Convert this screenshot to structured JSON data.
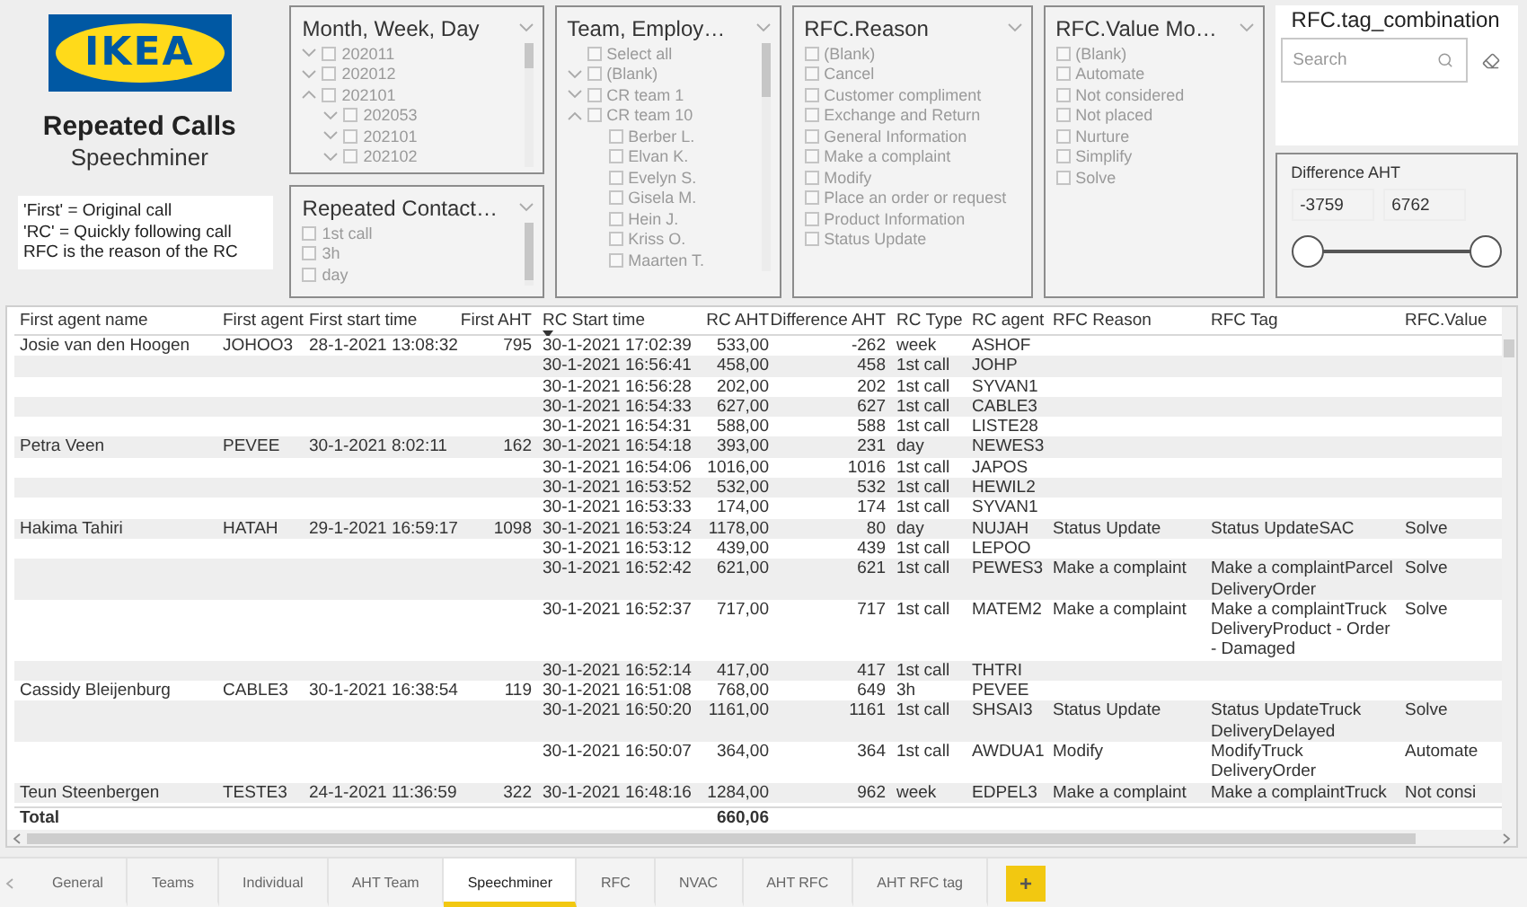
{
  "logo": {
    "text": "IKEA"
  },
  "title": "Repeated Calls",
  "subtitle": "Speechminer",
  "legend": [
    "'First' = Original call",
    "'RC' = Quickly following call",
    "RFC is the reason of the RC"
  ],
  "month_slicer": {
    "title": "Month, Week, Day",
    "items": [
      {
        "label": "202011",
        "checked": false,
        "expanded": false
      },
      {
        "label": "202012",
        "checked": false,
        "expanded": false
      },
      {
        "label": "202101",
        "checked": false,
        "expanded": true,
        "children": [
          {
            "label": "202053",
            "checked": false,
            "expanded": false
          },
          {
            "label": "202101",
            "checked": false,
            "expanded": false
          },
          {
            "label": "202102",
            "checked": false,
            "expanded": false
          }
        ]
      }
    ]
  },
  "contact_slicer": {
    "title": "Repeated Contact…",
    "items": [
      {
        "label": "1st call",
        "checked": false
      },
      {
        "label": "3h",
        "checked": false
      },
      {
        "label": "day",
        "checked": false
      }
    ]
  },
  "team_slicer": {
    "title": "Team, Employ…",
    "items": [
      {
        "label": "Select all",
        "checked": false
      },
      {
        "label": "(Blank)",
        "checked": false,
        "expanded": false
      },
      {
        "label": "CR team 1",
        "checked": false,
        "expanded": false
      },
      {
        "label": "CR team 10",
        "checked": false,
        "expanded": true,
        "children": [
          {
            "label": "Berber L.",
            "checked": false
          },
          {
            "label": "Elvan K.",
            "checked": false
          },
          {
            "label": "Evelyn S.",
            "checked": false
          },
          {
            "label": "Gisela M.",
            "checked": false
          },
          {
            "label": "Hein J.",
            "checked": false
          },
          {
            "label": "Kriss O.",
            "checked": false
          },
          {
            "label": "Maarten T.",
            "checked": false
          }
        ]
      }
    ]
  },
  "reason_slicer": {
    "title": "RFC.Reason",
    "items": [
      {
        "label": "(Blank)",
        "checked": false
      },
      {
        "label": "Cancel",
        "checked": false
      },
      {
        "label": "Customer compliment",
        "checked": false
      },
      {
        "label": "Exchange and Return",
        "checked": false
      },
      {
        "label": "General Information",
        "checked": false
      },
      {
        "label": "Make a complaint",
        "checked": false
      },
      {
        "label": "Modify",
        "checked": false
      },
      {
        "label": "Place an order or request",
        "checked": false
      },
      {
        "label": "Product Information",
        "checked": false
      },
      {
        "label": "Status Update",
        "checked": false
      }
    ]
  },
  "value_slicer": {
    "title": "RFC.Value Mo…",
    "items": [
      {
        "label": "(Blank)",
        "checked": false
      },
      {
        "label": "Automate",
        "checked": false
      },
      {
        "label": "Not considered",
        "checked": false
      },
      {
        "label": "Not placed",
        "checked": false
      },
      {
        "label": "Nurture",
        "checked": false
      },
      {
        "label": "Simplify",
        "checked": false
      },
      {
        "label": "Solve",
        "checked": false
      }
    ]
  },
  "tag_search": {
    "title": "RFC.tag_combination",
    "placeholder": "Search"
  },
  "difference_aht": {
    "title": "Difference AHT",
    "min": "-3759",
    "max": "6762",
    "handles": [
      {
        "level": 0
      },
      {
        "level": 1
      }
    ]
  },
  "table": {
    "columns": [
      {
        "label": "First agent name",
        "kind": "text",
        "sorted": false
      },
      {
        "label": "First agent",
        "kind": "text",
        "sorted": false
      },
      {
        "label": "First start time",
        "kind": "text",
        "sorted": false
      },
      {
        "label": "First AHT",
        "kind": "number",
        "sorted": false
      },
      {
        "label": "RC Start time",
        "kind": "text",
        "sorted": true
      },
      {
        "label": "RC AHT",
        "kind": "number",
        "sorted": false
      },
      {
        "label": "Difference AHT",
        "kind": "number",
        "sorted": false
      },
      {
        "label": "RC Type",
        "kind": "text",
        "sorted": false
      },
      {
        "label": "RC agent",
        "kind": "text",
        "sorted": false
      },
      {
        "label": "RFC Reason",
        "kind": "text",
        "sorted": false
      },
      {
        "label": "RFC Tag",
        "kind": "text",
        "sorted": false
      },
      {
        "label": "RFC.Value",
        "kind": "text",
        "sorted": false
      }
    ],
    "rows": [
      {
        "first_call": [
          "Josie van den Hoogen",
          "JOHOO3",
          "28-1-2021 13:08:32",
          "795"
        ],
        "repeat_call": [
          "30-1-2021 17:02:39",
          "533,00",
          "-262",
          "week",
          "ASHOF"
        ]
      },
      {
        "repeat_call": [
          "30-1-2021 16:56:41",
          "458,00",
          "458",
          "1st call",
          "JOHP"
        ]
      },
      {
        "repeat_call": [
          "30-1-2021 16:56:28",
          "202,00",
          "202",
          "1st call",
          "SYVAN1"
        ]
      },
      {
        "repeat_call": [
          "30-1-2021 16:54:33",
          "627,00",
          "627",
          "1st call",
          "CABLE3"
        ]
      },
      {
        "repeat_call": [
          "30-1-2021 16:54:31",
          "588,00",
          "588",
          "1st call",
          "LISTE28"
        ]
      },
      {
        "first_call": [
          "Petra Veen",
          "PEVEE",
          "30-1-2021 8:02:11",
          "162"
        ],
        "repeat_call": [
          "30-1-2021 16:54:18",
          "393,00",
          "231",
          "day",
          "NEWES3"
        ]
      },
      {
        "repeat_call": [
          "30-1-2021 16:54:06",
          "1016,00",
          "1016",
          "1st call",
          "JAPOS"
        ]
      },
      {
        "repeat_call": [
          "30-1-2021 16:53:52",
          "532,00",
          "532",
          "1st call",
          "HEWIL2"
        ]
      },
      {
        "repeat_call": [
          "30-1-2021 16:53:33",
          "174,00",
          "174",
          "1st call",
          "SYVAN1"
        ]
      },
      {
        "first_call": [
          "Hakima Tahiri",
          "HATAH",
          "29-1-2021 16:59:17",
          "1098"
        ],
        "repeat_call": [
          "30-1-2021 16:53:24",
          "1178,00",
          "80",
          "day",
          "NUJAH"
        ],
        "rfc": [
          "Status Update",
          "Status UpdateSAC",
          "Solve"
        ]
      },
      {
        "repeat_call": [
          "30-1-2021 16:53:12",
          "439,00",
          "439",
          "1st call",
          "LEPOO"
        ]
      },
      {
        "repeat_call": [
          "30-1-2021 16:52:42",
          "621,00",
          "621",
          "1st call",
          "PEWES3"
        ],
        "rfc": [
          "Make a complaint",
          "Make a complaintParcel DeliveryOrder",
          "Solve"
        ]
      },
      {
        "repeat_call": [
          "30-1-2021 16:52:37",
          "717,00",
          "717",
          "1st call",
          "MATEM2"
        ],
        "rfc": [
          "Make a complaint",
          "Make a complaintTruck DeliveryProduct - Order - Damaged",
          "Solve"
        ]
      },
      {
        "repeat_call": [
          "30-1-2021 16:52:14",
          "417,00",
          "417",
          "1st call",
          "THTRI"
        ]
      },
      {
        "first_call": [
          "Cassidy Bleijenburg",
          "CABLE3",
          "30-1-2021 16:38:54",
          "119"
        ],
        "repeat_call": [
          "30-1-2021 16:51:08",
          "768,00",
          "649",
          "3h",
          "PEVEE"
        ]
      },
      {
        "repeat_call": [
          "30-1-2021 16:50:20",
          "1161,00",
          "1161",
          "1st call",
          "SHSAI3"
        ],
        "rfc": [
          "Status Update",
          "Status UpdateTruck DeliveryDelayed",
          "Solve"
        ]
      },
      {
        "repeat_call": [
          "30-1-2021 16:50:07",
          "364,00",
          "364",
          "1st call",
          "AWDUA1"
        ],
        "rfc": [
          "Modify",
          "ModifyTruck DeliveryOrder",
          "Automate"
        ]
      },
      {
        "first_call": [
          "Teun Steenbergen",
          "TESTE3",
          "24-1-2021 11:36:59",
          "322"
        ],
        "repeat_call": [
          "30-1-2021 16:48:16",
          "1284,00",
          "962",
          "week",
          "EDPEL3"
        ],
        "rfc": [
          "Make a complaint",
          "Make a complaintTruck",
          "Not consi"
        ]
      }
    ],
    "total": {
      "label": "Total",
      "rc_aht": "660,06"
    }
  },
  "tabs": [
    {
      "label": "General",
      "selected": false
    },
    {
      "label": "Teams",
      "selected": false
    },
    {
      "label": "Individual",
      "selected": false
    },
    {
      "label": "AHT Team",
      "selected": false
    },
    {
      "label": "Speechminer",
      "selected": true
    },
    {
      "label": "RFC",
      "selected": false
    },
    {
      "label": "NVAC",
      "selected": false
    },
    {
      "label": "AHT RFC",
      "selected": false
    },
    {
      "label": "AHT RFC tag",
      "selected": false
    }
  ],
  "add_tab": "+"
}
